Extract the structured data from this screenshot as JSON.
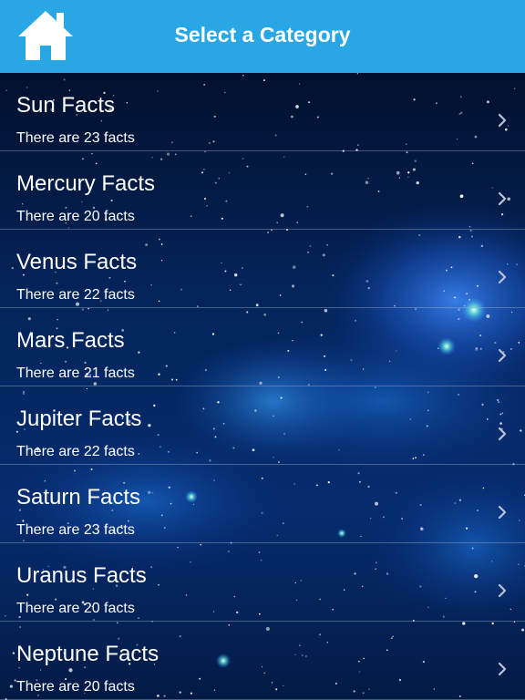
{
  "nav": {
    "title": "Select a Category",
    "home_icon": "home-icon",
    "color": "#29a6e4"
  },
  "categories": [
    {
      "title": "Sun Facts",
      "subtitle": "There are 23 facts"
    },
    {
      "title": "Mercury Facts",
      "subtitle": "There are 20 facts"
    },
    {
      "title": "Venus Facts",
      "subtitle": "There are 22 facts"
    },
    {
      "title": "Mars Facts",
      "subtitle": "There are 21 facts"
    },
    {
      "title": "Jupiter Facts",
      "subtitle": "There are 22 facts"
    },
    {
      "title": "Saturn Facts",
      "subtitle": "There are 23 facts"
    },
    {
      "title": "Uranus Facts",
      "subtitle": "There are 20 facts"
    },
    {
      "title": "Neptune Facts",
      "subtitle": "There are 20 facts"
    }
  ],
  "row_icon": "chevron-right-icon"
}
